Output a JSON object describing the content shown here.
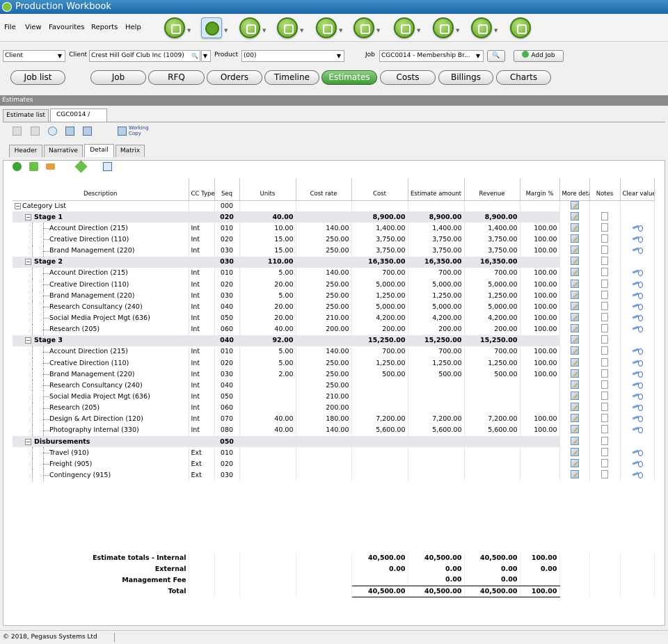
{
  "window": {
    "title": "Production Workbook"
  },
  "menu": [
    "File",
    "View",
    "Favourites",
    "Reports",
    "Help"
  ],
  "toolbar_icons": [
    "dashboard-icon",
    "jobs-icon",
    "money-icon",
    "media-icon",
    "chart-icon",
    "calculator-icon",
    "people-icon",
    "tools-icon",
    "monitor-icon",
    "leaf-icon"
  ],
  "filter": {
    "client_type": "Client",
    "client_label": "Client",
    "client_value": "Crest Hill Golf Club Inc (1009)",
    "product_label": "Product",
    "product_value": "(00)",
    "job_label": "Job",
    "job_value": "CGC0014  - Membership Br...",
    "add_job": "Add Job"
  },
  "nav": {
    "job_list": "Job list",
    "tabs": [
      "Job",
      "RFQ",
      "Orders",
      "Timeline",
      "Estimates",
      "Costs",
      "Billings",
      "Charts"
    ],
    "active": "Estimates"
  },
  "section": {
    "title": "Estimates"
  },
  "doc_tabs": [
    "Estimate list",
    "CGC0014  /"
  ],
  "working_copy": "Working Copy",
  "sub_tabs": [
    "Header",
    "Narrative",
    "Detail",
    "Matrix"
  ],
  "grid": {
    "headers": [
      "Description",
      "CC Type",
      "Seq",
      "Units",
      "Cost rate",
      "Cost",
      "Estimate amount",
      "Revenue",
      "Margin %",
      "More details",
      "Notes",
      "Clear values"
    ],
    "rows": [
      {
        "kind": "root",
        "desc": "Category List",
        "type": "",
        "seq": "000",
        "units": "",
        "rate": "",
        "cost": "",
        "est": "",
        "rev": "",
        "margin": ""
      },
      {
        "kind": "stage",
        "desc": "Stage 1",
        "type": "",
        "seq": "020",
        "units": "40.00",
        "rate": "",
        "cost": "8,900.00",
        "est": "8,900.00",
        "rev": "8,900.00",
        "margin": ""
      },
      {
        "kind": "item",
        "desc": "Account Direction (215)",
        "type": "Int",
        "seq": "010",
        "units": "10.00",
        "rate": "140.00",
        "cost": "1,400.00",
        "est": "1,400.00",
        "rev": "1,400.00",
        "margin": "100.00"
      },
      {
        "kind": "item",
        "desc": "Creative Direction (110)",
        "type": "Int",
        "seq": "020",
        "units": "15.00",
        "rate": "250.00",
        "cost": "3,750.00",
        "est": "3,750.00",
        "rev": "3,750.00",
        "margin": "100.00"
      },
      {
        "kind": "item",
        "desc": "Brand Management (220)",
        "type": "Int",
        "seq": "030",
        "units": "15.00",
        "rate": "250.00",
        "cost": "3,750.00",
        "est": "3,750.00",
        "rev": "3,750.00",
        "margin": "100.00"
      },
      {
        "kind": "stage",
        "desc": "Stage 2",
        "type": "",
        "seq": "030",
        "units": "110.00",
        "rate": "",
        "cost": "16,350.00",
        "est": "16,350.00",
        "rev": "16,350.00",
        "margin": ""
      },
      {
        "kind": "item",
        "desc": "Account Direction (215)",
        "type": "Int",
        "seq": "010",
        "units": "5.00",
        "rate": "140.00",
        "cost": "700.00",
        "est": "700.00",
        "rev": "700.00",
        "margin": "100.00"
      },
      {
        "kind": "item",
        "desc": "Creative Direction (110)",
        "type": "Int",
        "seq": "020",
        "units": "20.00",
        "rate": "250.00",
        "cost": "5,000.00",
        "est": "5,000.00",
        "rev": "5,000.00",
        "margin": "100.00"
      },
      {
        "kind": "item",
        "desc": "Brand Management (220)",
        "type": "Int",
        "seq": "030",
        "units": "5.00",
        "rate": "250.00",
        "cost": "1,250.00",
        "est": "1,250.00",
        "rev": "1,250.00",
        "margin": "100.00"
      },
      {
        "kind": "item",
        "desc": "Research Consultancy (240)",
        "type": "Int",
        "seq": "040",
        "units": "20.00",
        "rate": "250.00",
        "cost": "5,000.00",
        "est": "5,000.00",
        "rev": "5,000.00",
        "margin": "100.00"
      },
      {
        "kind": "item",
        "desc": "Social Media Project Mgt (636)",
        "type": "Int",
        "seq": "050",
        "units": "20.00",
        "rate": "210.00",
        "cost": "4,200.00",
        "est": "4,200.00",
        "rev": "4,200.00",
        "margin": "100.00"
      },
      {
        "kind": "item",
        "desc": "Research (205)",
        "type": "Int",
        "seq": "060",
        "units": "40.00",
        "rate": "200.00",
        "cost": "200.00",
        "est": "200.00",
        "rev": "200.00",
        "margin": "100.00"
      },
      {
        "kind": "stage",
        "desc": "Stage 3",
        "type": "",
        "seq": "040",
        "units": "92.00",
        "rate": "",
        "cost": "15,250.00",
        "est": "15,250.00",
        "rev": "15,250.00",
        "margin": ""
      },
      {
        "kind": "item",
        "desc": "Account Direction (215)",
        "type": "Int",
        "seq": "010",
        "units": "5.00",
        "rate": "140.00",
        "cost": "700.00",
        "est": "700.00",
        "rev": "700.00",
        "margin": "100.00"
      },
      {
        "kind": "item",
        "desc": "Creative Direction (110)",
        "type": "Int",
        "seq": "020",
        "units": "5.00",
        "rate": "250.00",
        "cost": "1,250.00",
        "est": "1,250.00",
        "rev": "1,250.00",
        "margin": "100.00"
      },
      {
        "kind": "item",
        "desc": "Brand Management (220)",
        "type": "Int",
        "seq": "030",
        "units": "2.00",
        "rate": "250.00",
        "cost": "500.00",
        "est": "500.00",
        "rev": "500.00",
        "margin": "100.00"
      },
      {
        "kind": "item",
        "desc": "Research Consultancy (240)",
        "type": "Int",
        "seq": "040",
        "units": "",
        "rate": "250.00",
        "cost": "",
        "est": "",
        "rev": "",
        "margin": ""
      },
      {
        "kind": "item",
        "desc": "Social Media Project Mgt (636)",
        "type": "Int",
        "seq": "050",
        "units": "",
        "rate": "210.00",
        "cost": "",
        "est": "",
        "rev": "",
        "margin": ""
      },
      {
        "kind": "item",
        "desc": "Research (205)",
        "type": "Int",
        "seq": "060",
        "units": "",
        "rate": "200.00",
        "cost": "",
        "est": "",
        "rev": "",
        "margin": ""
      },
      {
        "kind": "item",
        "desc": "Design & Art Direction (120)",
        "type": "Int",
        "seq": "070",
        "units": "40.00",
        "rate": "180.00",
        "cost": "7,200.00",
        "est": "7,200.00",
        "rev": "7,200.00",
        "margin": "100.00"
      },
      {
        "kind": "item",
        "desc": "Photography Internal (330)",
        "type": "Int",
        "seq": "080",
        "units": "40.00",
        "rate": "140.00",
        "cost": "5,600.00",
        "est": "5,600.00",
        "rev": "5,600.00",
        "margin": "100.00"
      },
      {
        "kind": "stage",
        "desc": "Disbursements",
        "type": "",
        "seq": "050",
        "units": "",
        "rate": "",
        "cost": "",
        "est": "",
        "rev": "",
        "margin": ""
      },
      {
        "kind": "item",
        "desc": "Travel (910)",
        "type": "Ext",
        "seq": "010",
        "units": "",
        "rate": "",
        "cost": "",
        "est": "",
        "rev": "",
        "margin": ""
      },
      {
        "kind": "item",
        "desc": "Freight (905)",
        "type": "Ext",
        "seq": "020",
        "units": "",
        "rate": "",
        "cost": "",
        "est": "",
        "rev": "",
        "margin": ""
      },
      {
        "kind": "item",
        "desc": "Contingency (915)",
        "type": "Ext",
        "seq": "030",
        "units": "",
        "rate": "",
        "cost": "",
        "est": "",
        "rev": "",
        "margin": ""
      }
    ]
  },
  "totals": [
    {
      "label": "Estimate totals - Internal",
      "cost": "40,500.00",
      "est": "40,500.00",
      "rev": "40,500.00",
      "margin": "100.00"
    },
    {
      "label": "External",
      "cost": "0.00",
      "est": "0.00",
      "rev": "0.00",
      "margin": "0.00"
    },
    {
      "label": "Management Fee",
      "cost": "",
      "est": "0.00",
      "rev": "0.00",
      "margin": ""
    },
    {
      "label": "Total",
      "cost": "40,500.00",
      "est": "40,500.00",
      "rev": "40,500.00",
      "margin": "100.00"
    }
  ],
  "status": {
    "copyright": "© 2018, Pegasus Systems Ltd"
  }
}
